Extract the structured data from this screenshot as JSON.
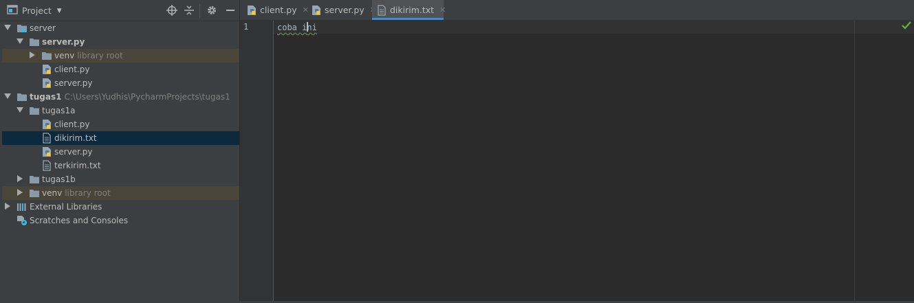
{
  "project_panel": {
    "title": "Project",
    "icons": [
      "project-view-icon",
      "locate-icon",
      "collapse-all-icon",
      "gear-icon",
      "hide-icon"
    ]
  },
  "tree": [
    {
      "name": "server",
      "hint": "",
      "type": "module",
      "expanded": true,
      "depth": 0,
      "bold": false
    },
    {
      "name": "server.py",
      "hint": "",
      "type": "folder",
      "expanded": true,
      "depth": 1,
      "bold": true
    },
    {
      "name": "venv",
      "hint": "library root",
      "type": "folder",
      "expanded": false,
      "depth": 2,
      "bold": false
    },
    {
      "name": "client.py",
      "hint": "",
      "type": "python-file",
      "depth": 2,
      "bold": false
    },
    {
      "name": "server.py",
      "hint": "",
      "type": "python-file",
      "depth": 2,
      "bold": false
    },
    {
      "name": "tugas1",
      "hint": "C:\\Users\\Yudhis\\PycharmProjects\\tugas1",
      "type": "folder",
      "expanded": true,
      "depth": 0,
      "bold": true
    },
    {
      "name": "tugas1a",
      "hint": "",
      "type": "folder",
      "expanded": true,
      "depth": 1,
      "bold": false
    },
    {
      "name": "client.py",
      "hint": "",
      "type": "python-file",
      "depth": 2,
      "bold": false
    },
    {
      "name": "dikirim.txt",
      "hint": "",
      "type": "text-file",
      "depth": 2,
      "bold": false,
      "selected": true
    },
    {
      "name": "server.py",
      "hint": "",
      "type": "python-file",
      "depth": 2,
      "bold": false
    },
    {
      "name": "terkirim.txt",
      "hint": "",
      "type": "text-file",
      "depth": 2,
      "bold": false
    },
    {
      "name": "tugas1b",
      "hint": "",
      "type": "folder",
      "expanded": false,
      "depth": 1,
      "bold": false
    },
    {
      "name": "venv",
      "hint": "library root",
      "type": "folder",
      "expanded": false,
      "depth": 1,
      "bold": false
    },
    {
      "name": "External Libraries",
      "hint": "",
      "type": "libraries",
      "expanded": false,
      "depth": 0,
      "bold": false
    },
    {
      "name": "Scratches and Consoles",
      "hint": "",
      "type": "scratches",
      "depth": 0,
      "bold": false
    }
  ],
  "tabs": [
    {
      "label": "client.py",
      "icon": "python-file-icon",
      "active": false
    },
    {
      "label": "server.py",
      "icon": "python-file-icon",
      "active": false
    },
    {
      "label": "dikirim.txt",
      "icon": "text-file-icon",
      "active": true
    }
  ],
  "tab_close_glyph": "✕",
  "editor": {
    "line_number": "1",
    "line_text_before_caret": "coba i",
    "line_text_after_caret": "ni"
  },
  "colors": {
    "panel_bg": "#3c3f41",
    "editor_bg": "#2b2b2b",
    "selection": "#0d293e",
    "library_root_highlight": "#4a4539",
    "active_tab_underline": "#4a88c7",
    "inspection_ok": "#62b543"
  }
}
